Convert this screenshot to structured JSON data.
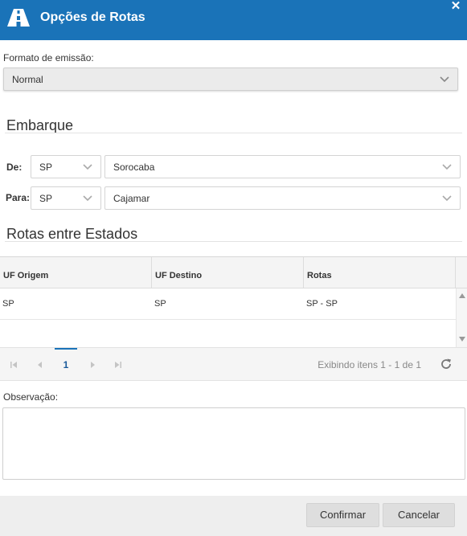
{
  "dialog": {
    "title": "Opções de Rotas",
    "close_symbol": "✕",
    "accent_color": "#1a73b8",
    "icon": "road-icon"
  },
  "format": {
    "label": "Formato de emissão:",
    "value": "Normal"
  },
  "embarque": {
    "title": "Embarque",
    "de_label": "De:",
    "de_uf": "SP",
    "de_city": "Sorocaba",
    "para_label": "Para:",
    "para_uf": "SP",
    "para_city": "Cajamar"
  },
  "rotas": {
    "title": "Rotas entre Estados",
    "columns": [
      "UF Origem",
      "UF Destino",
      "Rotas"
    ],
    "rows": [
      [
        "SP",
        "SP",
        "SP - SP"
      ]
    ],
    "pager": {
      "current_page": "1",
      "info": "Exibindo itens 1 - 1 de 1"
    }
  },
  "observacao": {
    "label": "Observação:",
    "value": ""
  },
  "footer": {
    "confirm_label": "Confirmar",
    "cancel_label": "Cancelar"
  }
}
